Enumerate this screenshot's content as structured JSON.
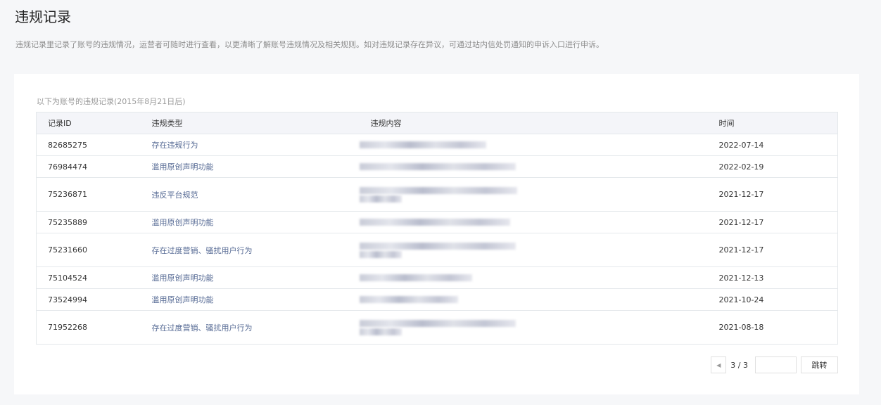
{
  "title": "违规记录",
  "description": "违规记录里记录了账号的违规情况，运营者可随时进行查看，以更清晰了解账号违规情况及相关规则。如对违规记录存在异议，可通过站内信处罚通知的申诉入口进行申诉。",
  "subtitle": "以下为账号的违规记录(2015年8月21日后)",
  "columns": [
    "记录ID",
    "违规类型",
    "违规内容",
    "时间"
  ],
  "rows": [
    {
      "id": "82685275",
      "type": "存在违规行为",
      "date": "2022-07-14"
    },
    {
      "id": "76984474",
      "type": "滥用原创声明功能",
      "date": "2022-02-19"
    },
    {
      "id": "75236871",
      "type": "违反平台规范",
      "date": "2021-12-17"
    },
    {
      "id": "75235889",
      "type": "滥用原创声明功能",
      "date": "2021-12-17"
    },
    {
      "id": "75231660",
      "type": "存在过度营销、骚扰用户行为",
      "date": "2021-12-17"
    },
    {
      "id": "75104524",
      "type": "滥用原创声明功能",
      "date": "2021-12-13"
    },
    {
      "id": "73524994",
      "type": "滥用原创声明功能",
      "date": "2021-10-24"
    },
    {
      "id": "71952268",
      "type": "存在过度营销、骚扰用户行为",
      "date": "2021-08-18"
    }
  ],
  "pager": {
    "page": "3 / 3",
    "jump_label": "跳转",
    "prev_icon": "triangle-left-icon"
  }
}
